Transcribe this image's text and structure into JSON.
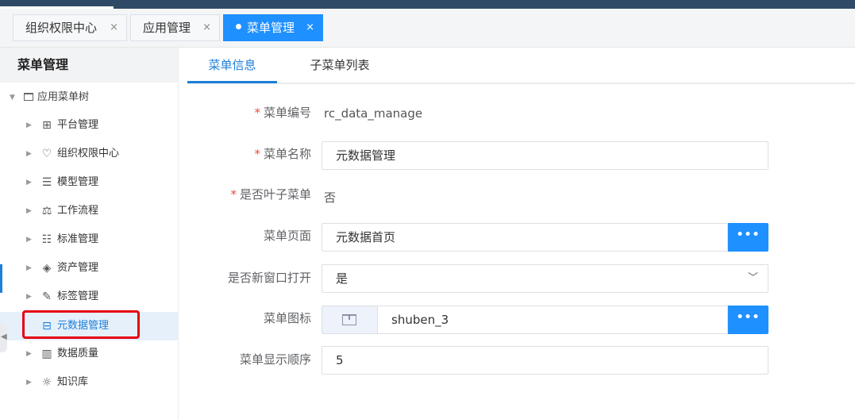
{
  "page_tabs": [
    {
      "label": "组织权限中心",
      "close": "×",
      "active": false
    },
    {
      "label": "应用管理",
      "close": "×",
      "active": false
    },
    {
      "label": "菜单管理",
      "close": "×",
      "active": true
    }
  ],
  "sidebar": {
    "title": "菜单管理",
    "root": {
      "label": "应用菜单树",
      "icon": "folder-icon"
    },
    "items": [
      {
        "label": "平台管理",
        "icon": "grid-icon"
      },
      {
        "label": "组织权限中心",
        "icon": "heart-shield-icon"
      },
      {
        "label": "模型管理",
        "icon": "database-icon"
      },
      {
        "label": "工作流程",
        "icon": "balance-scale-icon"
      },
      {
        "label": "标准管理",
        "icon": "list-icon"
      },
      {
        "label": "资产管理",
        "icon": "layers-icon"
      },
      {
        "label": "标签管理",
        "icon": "edit-icon"
      },
      {
        "label": "元数据管理",
        "icon": "book-icon",
        "selected": true
      },
      {
        "label": "数据质量",
        "icon": "bar-chart-icon"
      },
      {
        "label": "知识库",
        "icon": "lightbulb-icon"
      }
    ]
  },
  "content_tabs": [
    {
      "label": "菜单信息",
      "active": true
    },
    {
      "label": "子菜单列表",
      "active": false
    }
  ],
  "form": {
    "menu_code": {
      "label": "菜单编号",
      "required": true,
      "value": "rc_data_manage"
    },
    "menu_name": {
      "label": "菜单名称",
      "required": true,
      "value": "元数据管理"
    },
    "is_leaf": {
      "label": "是否叶子菜单",
      "required": true,
      "value": "否"
    },
    "menu_page": {
      "label": "菜单页面",
      "value": "元数据首页",
      "button": "•••"
    },
    "new_window": {
      "label": "是否新窗口打开",
      "value": "是"
    },
    "menu_icon": {
      "label": "菜单图标",
      "value": "shuben_3",
      "button": "•••"
    },
    "display_order": {
      "label": "菜单显示顺序",
      "value": "5"
    }
  },
  "colors": {
    "accent": "#1e90ff",
    "required": "#e84c3d",
    "highlight_box": "#e60012"
  }
}
